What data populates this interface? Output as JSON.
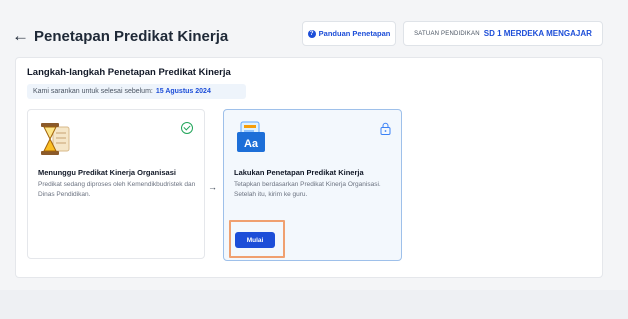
{
  "header": {
    "back_icon": "arrow-left-icon",
    "title": "Penetapan Predikat Kinerja",
    "guide_label": "Panduan Penetapan",
    "guide_icon": "question-circle-icon",
    "school_label": "SATUAN PENDIDIKAN",
    "school_value": "SD 1 MERDEKA MENGAJAR"
  },
  "steps": {
    "title": "Langkah-langkah Penetapan Predikat Kinerja",
    "deadline_text": "Kami sarankan untuk selesai sebelum:",
    "deadline_date": "15 Agustus 2024",
    "items": [
      {
        "icon": "hourglass-icon",
        "status_icon": "check-circle-icon",
        "title": "Menunggu Predikat Kinerja Organisasi",
        "description": "Predikat sedang diproses oleh Kemendikbudristek dan Dinas Pendidikan."
      },
      {
        "icon": "document-font-icon",
        "status_icon": "lock-icon",
        "title": "Lakukan Penetapan Predikat Kinerja",
        "description": "Tetapkan berdasarkan Predikat Kinerja Organisasi. Setelah itu, kirim ke guru.",
        "button_label": "Mulai"
      }
    ]
  },
  "colors": {
    "accent": "#1d4ed8",
    "success": "#22a55a",
    "highlight": "#f0a070"
  }
}
